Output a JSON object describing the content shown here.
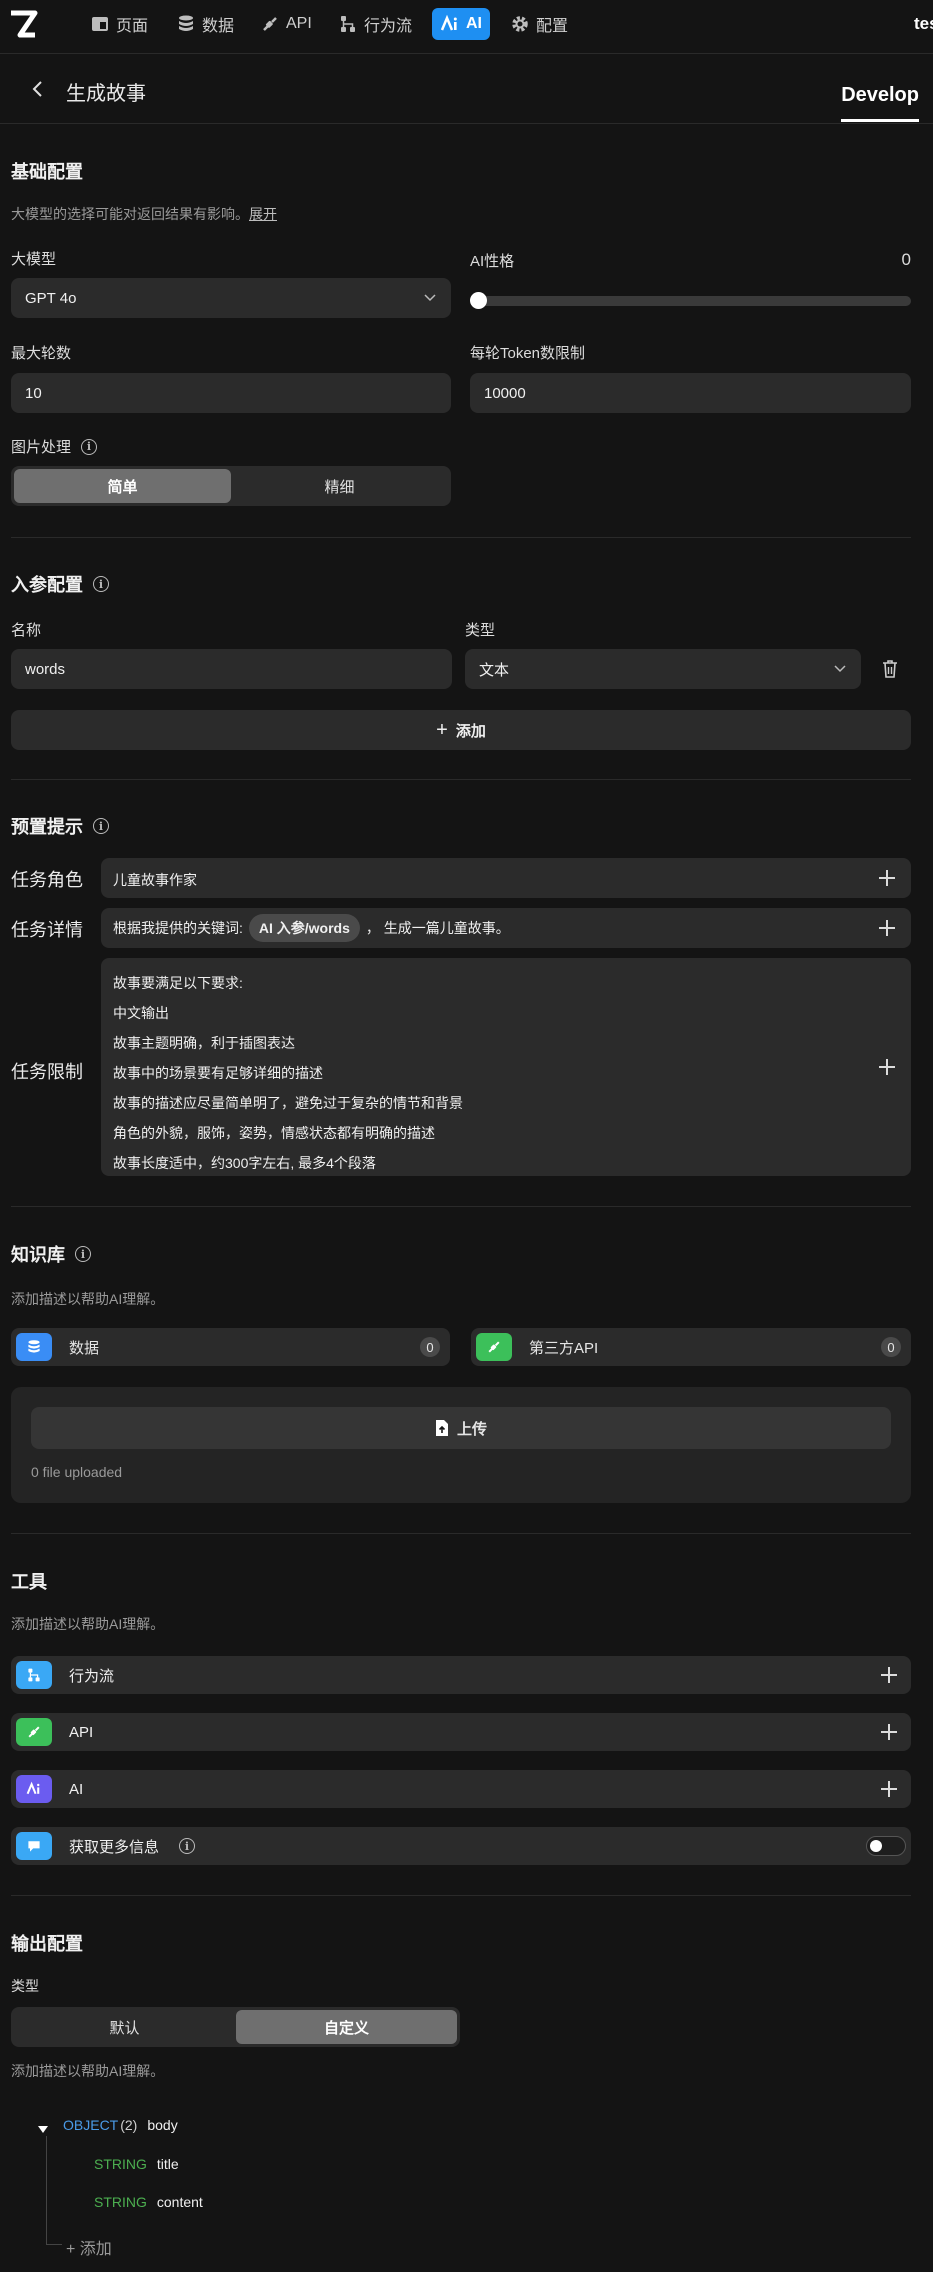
{
  "nav": {
    "items": [
      {
        "label": "页面",
        "icon": "page-icon"
      },
      {
        "label": "数据",
        "icon": "database-icon"
      },
      {
        "label": "API",
        "icon": "api-plug-icon"
      },
      {
        "label": "行为流",
        "icon": "workflow-icon"
      },
      {
        "label": "AI",
        "icon": "ai-icon",
        "active": true
      },
      {
        "label": "配置",
        "icon": "gear-icon"
      }
    ],
    "right_text": "tes"
  },
  "header": {
    "title": "生成故事",
    "tab": "Develop"
  },
  "basic": {
    "title": "基础配置",
    "hint": "大模型的选择可能对返回结果有影响。",
    "expand": "展开",
    "model_label": "大模型",
    "model_value": "GPT 4o",
    "personality_label": "AI性格",
    "personality_value": "0",
    "personality_level": 0,
    "max_rounds_label": "最大轮数",
    "max_rounds_value": "10",
    "token_label": "每轮Token数限制",
    "token_value": "10000",
    "image_label": "图片处理",
    "image_options": [
      "简单",
      "精细"
    ],
    "image_selected": "简单"
  },
  "params": {
    "title": "入参配置",
    "name_label": "名称",
    "type_label": "类型",
    "name_value": "words",
    "type_value": "文本",
    "add_label": "添加"
  },
  "prompt": {
    "title": "预置提示",
    "role_label": "任务角色",
    "role_value": "儿童故事作家",
    "detail_label": "任务详情",
    "detail_before": "根据我提供的关键词:",
    "detail_chip": "AI 入参/words",
    "detail_after": "， 生成一篇儿童故事。",
    "limit_label": "任务限制",
    "limit_lines": [
      "故事要满足以下要求:",
      "中文输出",
      "故事主题明确，利于插图表达",
      "故事中的场景要有足够详细的描述",
      "故事的描述应尽量简单明了，避免过于复杂的情节和背景",
      "角色的外貌，服饰，姿势，情感状态都有明确的描述",
      "故事长度适中，约300字左右, 最多4个段落"
    ]
  },
  "knowledge": {
    "title": "知识库",
    "hint": "添加描述以帮助AI理解。",
    "data_label": "数据",
    "data_count": "0",
    "api_label": "第三方API",
    "api_count": "0",
    "upload_label": "上传",
    "uploaded_text": "0 file uploaded"
  },
  "tools": {
    "title": "工具",
    "hint": "添加描述以帮助AI理解。",
    "items": [
      {
        "label": "行为流",
        "icon": "workflow-icon",
        "color": "#3aa8f5"
      },
      {
        "label": "API",
        "icon": "api-plug-icon",
        "color": "#3cc05a"
      },
      {
        "label": "AI",
        "icon": "ai-icon",
        "color": "#6b5cf0"
      }
    ],
    "more_info_label": "获取更多信息",
    "more_info_enabled": false
  },
  "output": {
    "title": "输出配置",
    "type_label": "类型",
    "options": [
      "默认",
      "自定义"
    ],
    "selected": "自定义",
    "hint": "添加描述以帮助AI理解。",
    "root_type": "OBJECT",
    "root_count": "(2)",
    "root_name": "body",
    "fields": [
      {
        "type": "STRING",
        "name": "title"
      },
      {
        "type": "STRING",
        "name": "content"
      }
    ],
    "add_label": "+ 添加"
  },
  "colors": {
    "accent": "#1e8ff2",
    "string_type": "#4caf50",
    "object_type": "#4a9be8"
  }
}
